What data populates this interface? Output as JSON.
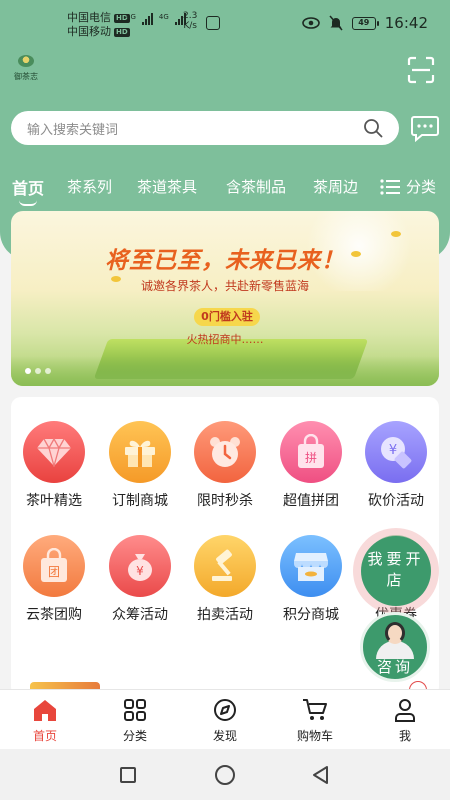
{
  "status_bar": {
    "carrier_1": "中国电信",
    "carrier_2": "中国移动",
    "hd": "HD",
    "net_type": "4G",
    "speed_value": "2.3",
    "speed_unit": "K/s",
    "battery": "49",
    "time": "16:42"
  },
  "header": {
    "logo_text": "御茶志",
    "search_placeholder": "输入搜索关键词"
  },
  "tabs": {
    "items": [
      "首页",
      "茶系列",
      "茶道茶具",
      "含茶制品",
      "茶周边"
    ],
    "active_index": 0,
    "category_label": "分类"
  },
  "banner": {
    "title": "将至已至，未来已来！",
    "subtitle": "诚邀各界茶人，共赴新零售蓝海",
    "pill": "0门槛入驻",
    "note": "火热招商中……",
    "slide_count": 3,
    "active_slide": 0
  },
  "features": [
    {
      "label": "茶叶精选",
      "icon": "diamond-icon"
    },
    {
      "label": "订制商城",
      "icon": "gift-icon"
    },
    {
      "label": "限时秒杀",
      "icon": "alarm-clock-icon"
    },
    {
      "label": "超值拼团",
      "icon": "shopping-bag-icon"
    },
    {
      "label": "砍价活动",
      "icon": "price-tag-icon"
    },
    {
      "label": "云茶团购",
      "icon": "group-bag-icon"
    },
    {
      "label": "众筹活动",
      "icon": "money-bag-icon"
    },
    {
      "label": "拍卖活动",
      "icon": "gavel-icon"
    },
    {
      "label": "积分商城",
      "icon": "store-icon"
    },
    {
      "label": "优惠券",
      "icon": "coupon-icon"
    }
  ],
  "floating": {
    "open_store": "我要开店",
    "consult": "咨询"
  },
  "bottom_nav": [
    {
      "label": "首页",
      "icon": "home-icon",
      "active": true
    },
    {
      "label": "分类",
      "icon": "grid-icon",
      "active": false
    },
    {
      "label": "发现",
      "icon": "compass-icon",
      "active": false
    },
    {
      "label": "购物车",
      "icon": "cart-icon",
      "active": false
    },
    {
      "label": "我",
      "icon": "person-icon",
      "active": false
    }
  ],
  "colors": {
    "brand_green": "#7ebf9b",
    "accent_red": "#e8463c",
    "float_green": "#3d9a6c"
  }
}
